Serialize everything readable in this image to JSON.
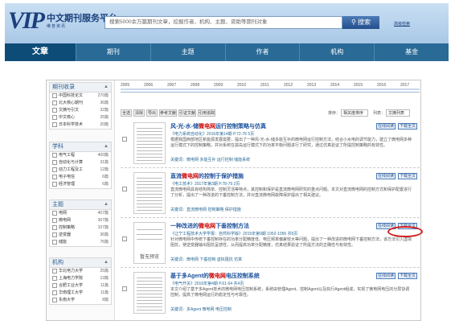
{
  "brand": {
    "logo": "VIP",
    "name": "中文期刊服务平台",
    "tagline": "维普资讯"
  },
  "search": {
    "placeholder": "搜索5000余万篇期刊文章，挖掘作者、机构、主题、资助等期刊对象",
    "button": "搜索",
    "advanced": "高级检索"
  },
  "nav": [
    "文章",
    "期刊",
    "主题",
    "作者",
    "机构",
    "基金"
  ],
  "timeline_years": [
    "2005",
    "2006",
    "2007",
    "2008",
    "2009",
    "2010",
    "2011",
    "2012",
    "2013",
    "2014",
    "2015",
    "2016",
    "2017"
  ],
  "facets": [
    {
      "title": "期刊收录",
      "items": [
        {
          "label": "中国科技论文",
          "count": "270篇"
        },
        {
          "label": "北大核心期刊",
          "count": "36篇"
        },
        {
          "label": "文摘与引文",
          "count": "32篇"
        },
        {
          "label": "中文核心",
          "count": "25篇"
        },
        {
          "label": "日本科学技术",
          "count": "20篇"
        }
      ]
    },
    {
      "title": "学科",
      "items": [
        {
          "label": "电气工程",
          "count": "400篇"
        },
        {
          "label": "自动化与计算",
          "count": "31篇"
        },
        {
          "label": "动力工程及工",
          "count": "12篇"
        },
        {
          "label": "电子电信",
          "count": "6篇"
        },
        {
          "label": "经济管理",
          "count": "6篇"
        }
      ]
    },
    {
      "title": "主题",
      "items": [
        {
          "label": "电网",
          "count": "407篇"
        },
        {
          "label": "微电网",
          "count": "307篇"
        },
        {
          "label": "控制策略",
          "count": "107篇"
        },
        {
          "label": "逆变器",
          "count": "36篇"
        },
        {
          "label": "储能",
          "count": "76篇"
        }
      ]
    },
    {
      "title": "机构",
      "items": [
        {
          "label": "华北电力大学",
          "count": "25篇"
        },
        {
          "label": "上海电力学院",
          "count": "13篇"
        },
        {
          "label": "合肥工业大学",
          "count": "11篇"
        },
        {
          "label": "华南理工大学",
          "count": "11篇"
        },
        {
          "label": "东南大学",
          "count": "8篇"
        }
      ]
    }
  ],
  "toolbar": {
    "buttons": [
      "全选",
      "清除",
      "导出",
      "参考文献",
      "引证文献",
      "引用追踪"
    ],
    "sort_label": "排序：",
    "sort_value": "相关度排序",
    "view_label": "列表：",
    "view_value": "文摘列表"
  },
  "results": [
    {
      "title_pre": "风-光-水-储",
      "title_hl": "微电网",
      "title_post": "运行控制策略与仿真",
      "meta": "《电力系统自动化》2016年第14期 P.72-76 5页",
      "abstract": "根据我国西部地区新能源发展需要，提出了一种风-光-水-储多能互补的微电网运行控制方法，结合小水电的调节能力，建立了微电网多种运行模式下的控制策略，并对系统在孤岛运行模式下的功率平衡问题进行了研究，通过仿真验证了所提控制策略的有效性。",
      "keywords": "关键词：微电网  多能互补  运行控制  储能系统",
      "actions": [
        "在线阅读",
        "下载全文"
      ]
    },
    {
      "title_pre": "直流",
      "title_hl": "微电网",
      "title_post": "的控制于保护措施",
      "meta": "《电工技术》2017年第3期 P.78-79 2页",
      "abstract": "直流微电网具有结构简单、控制灵活等特点，其控制和保护是直流微电网研究的重点问题。本文对直流微电网的控制方式和保护配置进行了分析，提出了一种改进的下垂控制方法，并对直流微电网故障保护提出了相关建议。",
      "keywords": "关键词：直流微电网  控制策略  保护措施",
      "actions": [
        "在线阅读",
        "下载全文"
      ]
    },
    {
      "title_pre": "一种改进的",
      "title_hl": "微电网",
      "title_post": "下垂控制方法",
      "meta": "《辽宁工程技术大学学报：自然科学版》2015年第9期 1052-1056 共5页",
      "abstract": "针对微电网中传统下垂控制存在的功率分配精度低、电压频率偏差较大等问题，提出了一种改进的微电网下垂控制方法，该方法引入虚拟阻抗，使逆变器输出阻抗呈感性，从而提高功率分配精度，仿真结果验证了所提方法的正确性与有效性。",
      "keywords": "关键词：微电网  下垂控制  虚拟阻抗  仿真",
      "actions": [
        "在线阅读",
        "下载全文"
      ],
      "thumb_label": "暂无预览"
    },
    {
      "title_pre": "基于多Agent的",
      "title_hl": "微电网",
      "title_post": "电压控制系统",
      "meta": "《电气开关》2016年第4期 P.61-64 共4页",
      "abstract": "本文介绍了基于多Agent技术的微电网电压控制系统，系统由管理Agent、控制Agent以及执行Agent组成，实现了微电网电压的分层协调控制，提高了微电网运行的稳定性与可靠性。",
      "keywords": "关键词：多Agent  微电网  电压控制",
      "actions": [
        "在线阅读",
        "下载全文"
      ]
    }
  ]
}
